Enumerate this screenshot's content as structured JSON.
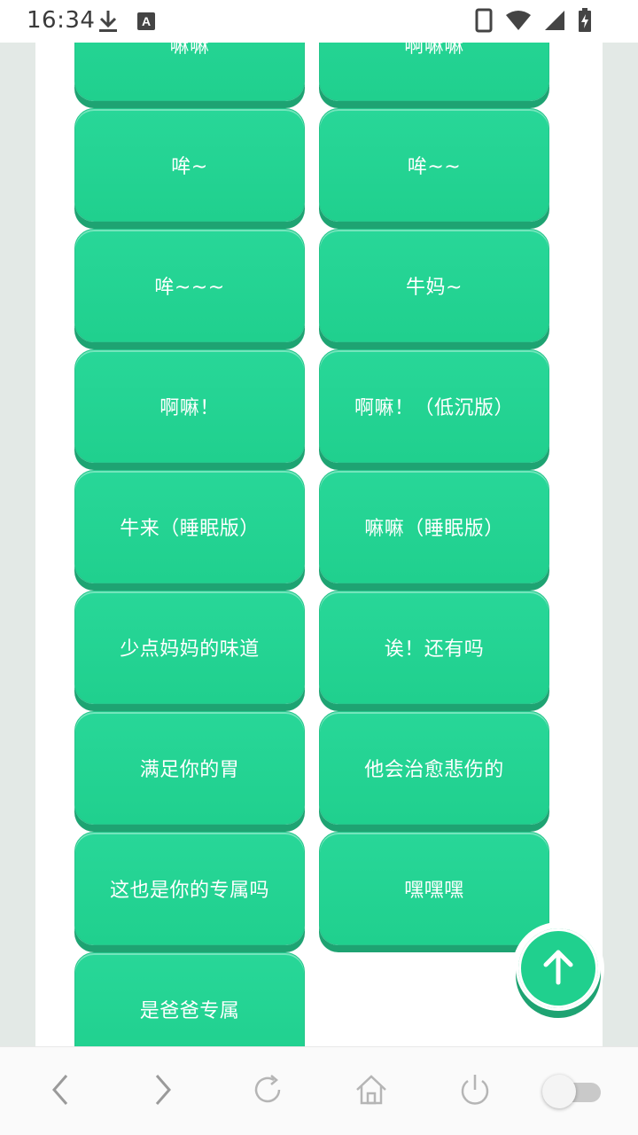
{
  "status_bar": {
    "time": "16:34",
    "left_icons": [
      "download-icon",
      "a-text-icon"
    ],
    "right_icons": [
      "phone-icon",
      "wifi-icon",
      "signal-icon",
      "battery-charging-icon"
    ]
  },
  "buttons": [
    {
      "label": "嘛嘛"
    },
    {
      "label": "啊嘛嘛"
    },
    {
      "label": "哞~"
    },
    {
      "label": "哞~~"
    },
    {
      "label": "哞~~~"
    },
    {
      "label": "牛妈~"
    },
    {
      "label": "啊嘛！"
    },
    {
      "label": "啊嘛！（低沉版）"
    },
    {
      "label": "牛来（睡眠版）"
    },
    {
      "label": "嘛嘛（睡眠版）"
    },
    {
      "label": "少点妈妈的味道"
    },
    {
      "label": "诶！还有吗"
    },
    {
      "label": "满足你的胃"
    },
    {
      "label": "他会治愈悲伤的"
    },
    {
      "label": "这也是你的专属吗"
    },
    {
      "label": "嘿嘿嘿"
    },
    {
      "label": "是爸爸专属"
    }
  ],
  "fab": {
    "icon": "arrow-up-icon"
  },
  "bottom_nav": {
    "icons": [
      "back-icon",
      "forward-icon",
      "refresh-icon",
      "home-icon",
      "power-icon",
      "toggle-switch"
    ]
  },
  "colors": {
    "button_green": "#20d08e",
    "button_shadow": "#1ea372",
    "page_bg": "#e3e9e6"
  }
}
